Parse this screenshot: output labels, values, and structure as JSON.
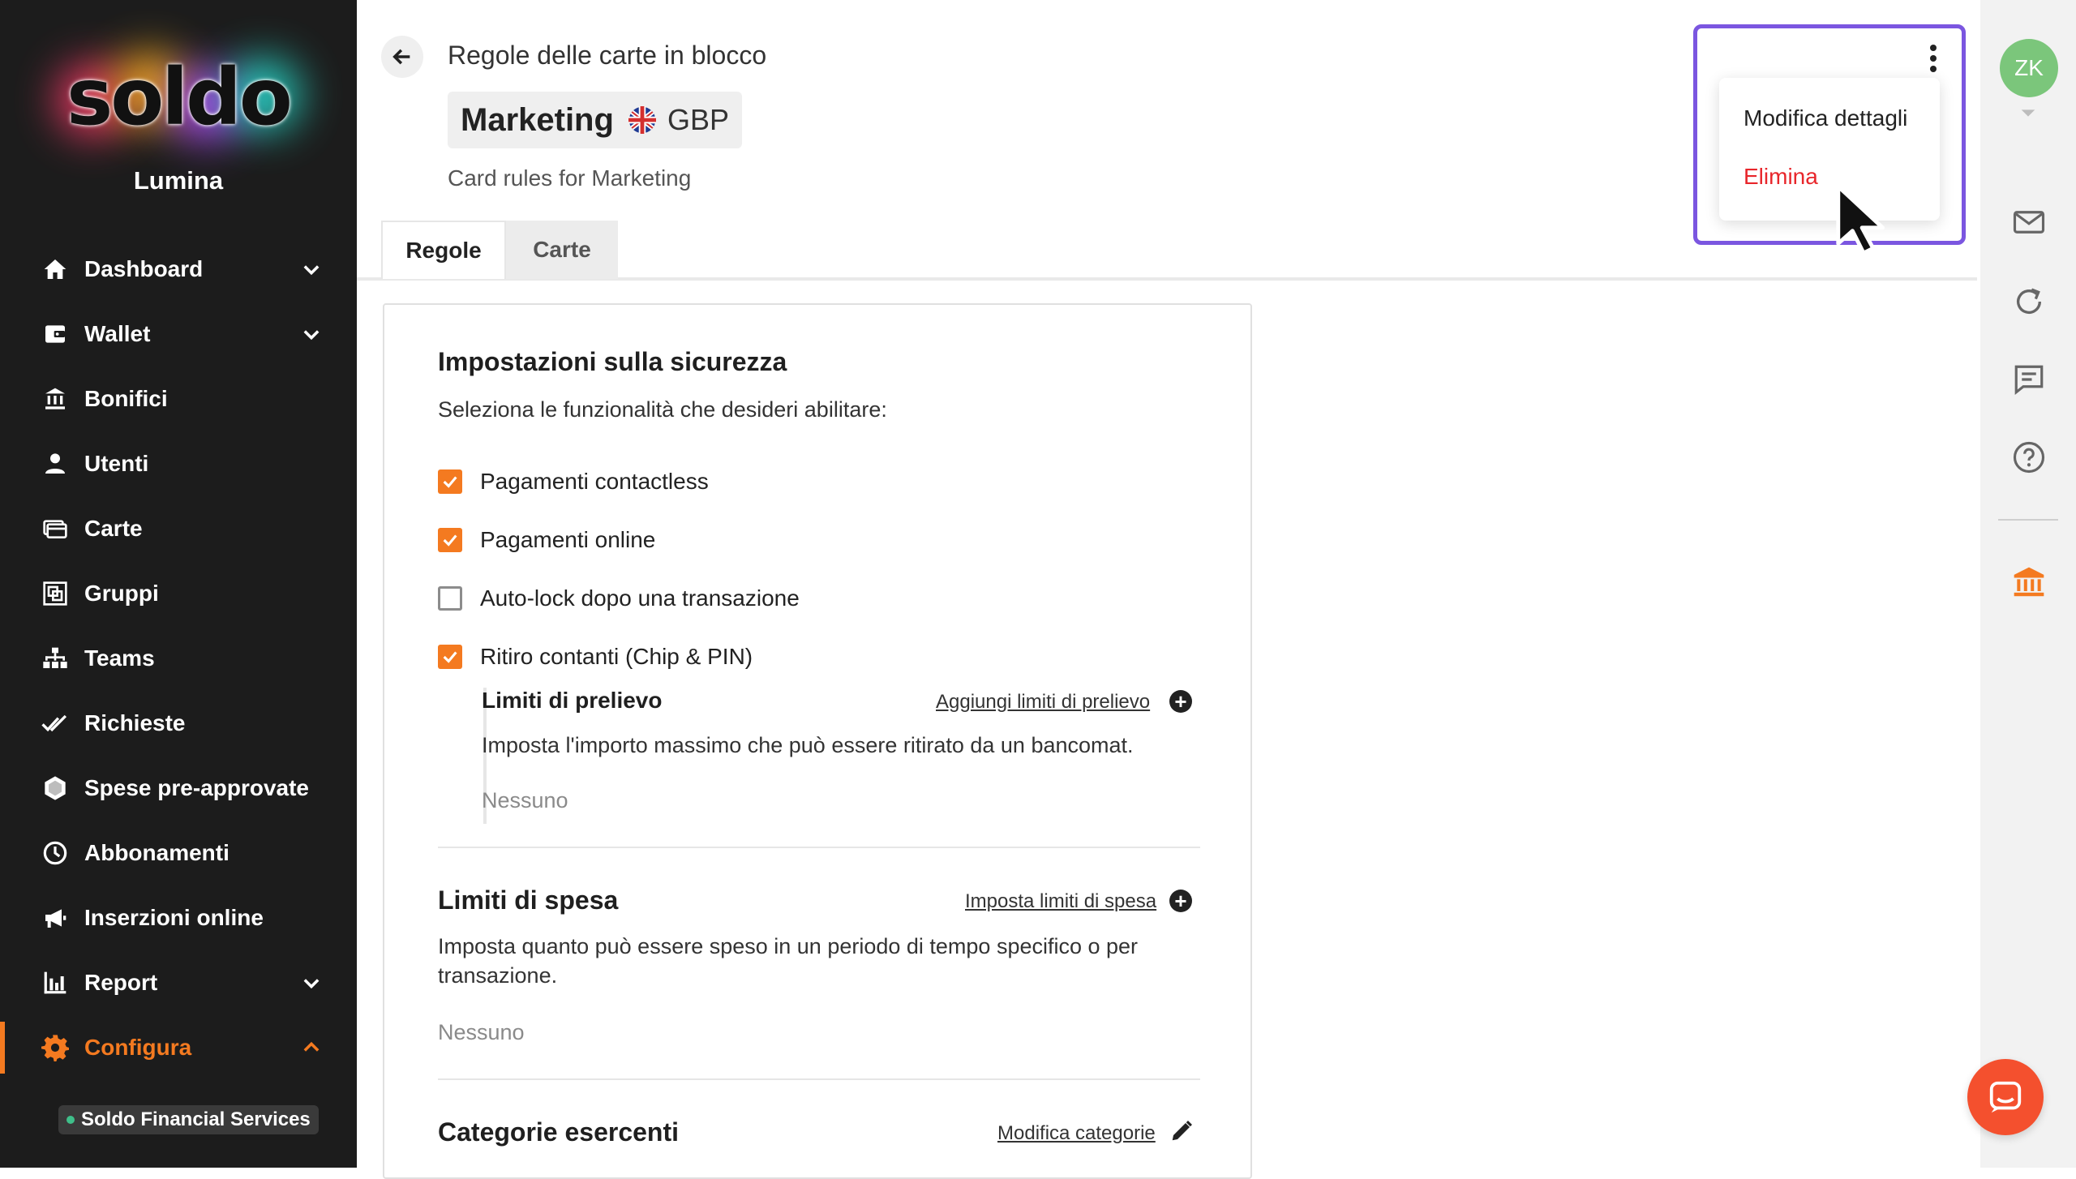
{
  "sidebar": {
    "logo_text": "soldo",
    "org_name": "Lumina",
    "items": [
      {
        "label": "Dashboard",
        "icon": "home-icon",
        "expandable": true
      },
      {
        "label": "Wallet",
        "icon": "wallet-icon",
        "expandable": true
      },
      {
        "label": "Bonifici",
        "icon": "bank-transfer-icon",
        "expandable": false
      },
      {
        "label": "Utenti",
        "icon": "user-icon",
        "expandable": false
      },
      {
        "label": "Carte",
        "icon": "cards-icon",
        "expandable": false
      },
      {
        "label": "Gruppi",
        "icon": "groups-icon",
        "expandable": false
      },
      {
        "label": "Teams",
        "icon": "teams-hierarchy-icon",
        "expandable": false
      },
      {
        "label": "Richieste",
        "icon": "double-check-icon",
        "expandable": false
      },
      {
        "label": "Spese pre-approvate",
        "icon": "hexagon-icon",
        "expandable": false
      },
      {
        "label": "Abbonamenti",
        "icon": "clock-icon",
        "expandable": false
      },
      {
        "label": "Inserzioni online",
        "icon": "megaphone-icon",
        "expandable": false
      },
      {
        "label": "Report",
        "icon": "bar-chart-icon",
        "expandable": true
      },
      {
        "label": "Configura",
        "icon": "gear-icon",
        "expandable": true,
        "active": true
      }
    ],
    "footer_badge": "Soldo Financial Services"
  },
  "header": {
    "breadcrumb": "Regole delle carte in blocco",
    "title": "Marketing",
    "currency": "GBP",
    "subtitle": "Card rules for Marketing"
  },
  "tabs": [
    {
      "label": "Regole",
      "active": true
    },
    {
      "label": "Carte",
      "active": false
    }
  ],
  "menu": {
    "edit_label": "Modifica dettagli",
    "delete_label": "Elimina"
  },
  "security": {
    "title": "Impostazioni sulla sicurezza",
    "intro": "Seleziona le funzionalità che desideri abilitare:",
    "options": [
      {
        "label": "Pagamenti contactless",
        "checked": true
      },
      {
        "label": "Pagamenti online",
        "checked": true
      },
      {
        "label": "Auto-lock dopo una transazione",
        "checked": false
      },
      {
        "label": "Ritiro contanti (Chip & PIN)",
        "checked": true
      }
    ],
    "withdrawal": {
      "title": "Limiti di prelievo",
      "link": "Aggiungi limiti di prelievo",
      "description": "Imposta l'importo massimo che può essere ritirato da un bancomat.",
      "value": "Nessuno"
    }
  },
  "spending": {
    "title": "Limiti di spesa",
    "link": "Imposta limiti di spesa",
    "description_line1": "Imposta quanto può essere speso in un periodo di tempo specifico o per",
    "description_line2": "transazione.",
    "value": "Nessuno"
  },
  "merchants": {
    "title": "Categorie esercenti",
    "link": "Modifica categorie"
  },
  "user": {
    "initials": "ZK"
  },
  "colors": {
    "accent": "#f47a20",
    "danger": "#e8262b",
    "highlight": "#7b56e0",
    "chat": "#f4502e"
  }
}
